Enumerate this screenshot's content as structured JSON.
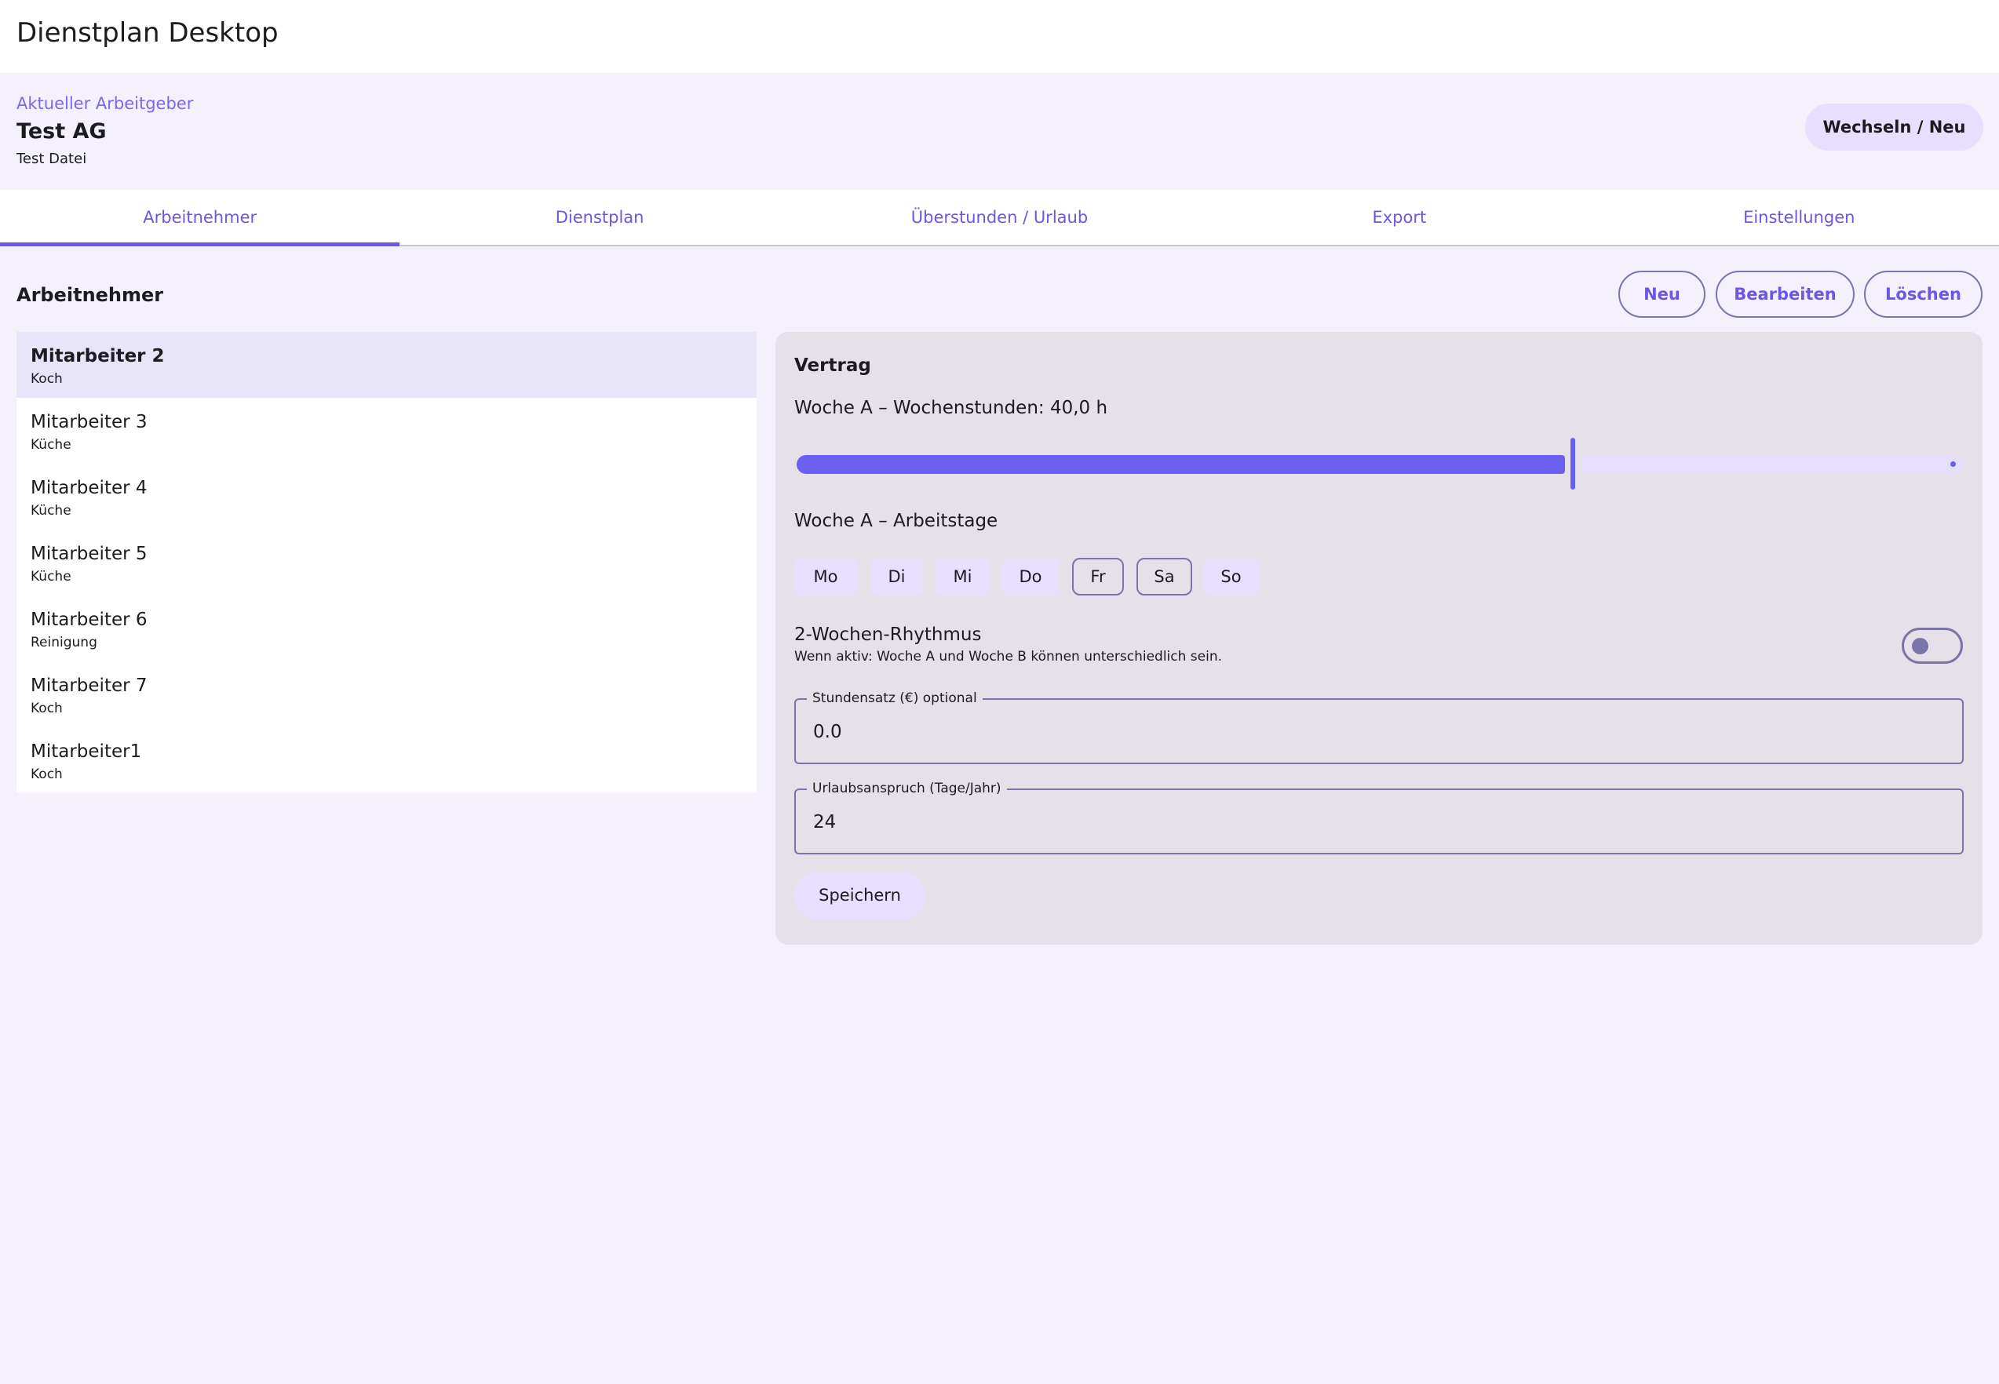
{
  "app": {
    "title": "Dienstplan Desktop"
  },
  "employer": {
    "caption": "Aktueller Arbeitgeber",
    "name": "Test AG",
    "file": "Test Datei",
    "switch_label": "Wechseln / Neu"
  },
  "tabs": [
    {
      "label": "Arbeitnehmer",
      "active": true
    },
    {
      "label": "Dienstplan",
      "active": false
    },
    {
      "label": "Überstunden / Urlaub",
      "active": false
    },
    {
      "label": "Export",
      "active": false
    },
    {
      "label": "Einstellungen",
      "active": false
    }
  ],
  "section": {
    "title": "Arbeitnehmer",
    "new_label": "Neu",
    "edit_label": "Bearbeiten",
    "delete_label": "Löschen"
  },
  "employees": [
    {
      "name": "Mitarbeiter 2",
      "role": "Koch",
      "selected": true
    },
    {
      "name": "Mitarbeiter 3",
      "role": "Küche",
      "selected": false
    },
    {
      "name": "Mitarbeiter 4",
      "role": "Küche",
      "selected": false
    },
    {
      "name": "Mitarbeiter 5",
      "role": "Küche",
      "selected": false
    },
    {
      "name": "Mitarbeiter 6",
      "role": "Reinigung",
      "selected": false
    },
    {
      "name": "Mitarbeiter 7",
      "role": "Koch",
      "selected": false
    },
    {
      "name": "Mitarbeiter1",
      "role": "Koch",
      "selected": false
    }
  ],
  "contract": {
    "title": "Vertrag",
    "hours_label": "Woche A – Wochenstunden: 40,0 h",
    "hours_slider_fraction": 0.67,
    "days_label": "Woche A – Arbeitstage",
    "days": [
      {
        "label": "Mo",
        "selected": true
      },
      {
        "label": "Di",
        "selected": true
      },
      {
        "label": "Mi",
        "selected": true
      },
      {
        "label": "Do",
        "selected": true
      },
      {
        "label": "Fr",
        "selected": false
      },
      {
        "label": "Sa",
        "selected": false
      },
      {
        "label": "So",
        "selected": true
      }
    ],
    "rhythm_label": "2-Wochen-Rhythmus",
    "rhythm_desc": "Wenn aktiv: Woche A und Woche B können unterschiedlich sein.",
    "rhythm_enabled": false,
    "rate_label": "Stundensatz (€) optional",
    "rate_value": "0.0",
    "vacation_label": "Urlaubsanspruch (Tage/Jahr)",
    "vacation_value": "24",
    "save_label": "Speichern"
  },
  "colors": {
    "accent": "#6c56e6",
    "tonal": "#e8defe",
    "background": "#f4f1fd",
    "panel": "#e6e0e9",
    "outline": "#7a74a8"
  }
}
